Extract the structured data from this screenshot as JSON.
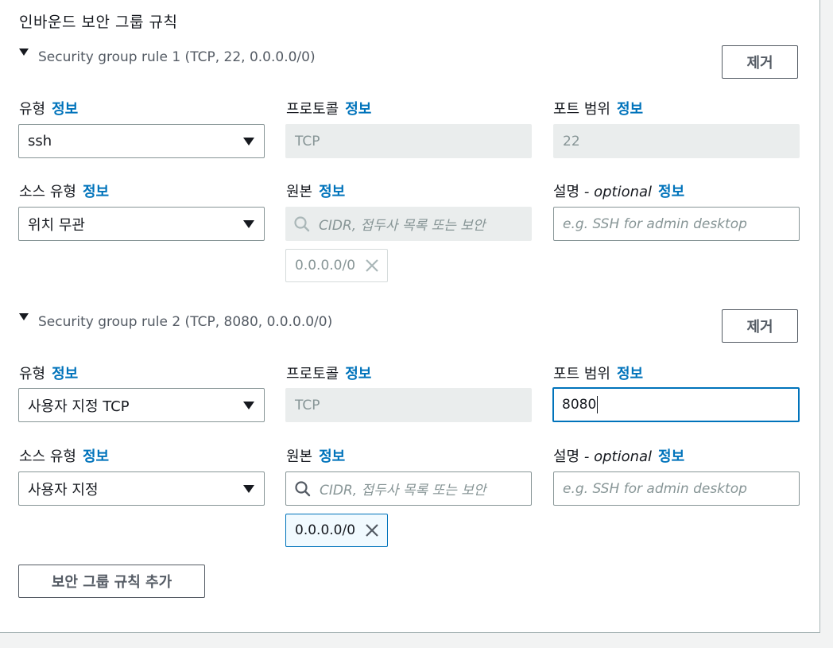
{
  "section_title": "인바운드 보안 그룹 규칙",
  "info_link": "정보",
  "remove_label": "제거",
  "add_rule_label": "보안 그룹 규칙 추가",
  "labels": {
    "type": "유형",
    "protocol": "프로토콜",
    "port_range": "포트 범위",
    "source_type": "소스 유형",
    "source": "원본",
    "description": "설명",
    "description_optional": "- optional"
  },
  "rules": [
    {
      "title": "Security group rule 1 (TCP, 22, 0.0.0.0/0)",
      "type_value": "ssh",
      "protocol_value": "TCP",
      "port_value": "22",
      "source_type_value": "위치 무관",
      "source_placeholder": "CIDR, 접두사 목록 또는 보안",
      "source_token": "0.0.0.0/0",
      "description_placeholder": "e.g. SSH for admin desktop"
    },
    {
      "title": "Security group rule 2 (TCP, 8080, 0.0.0.0/0)",
      "type_value": "사용자 지정 TCP",
      "protocol_value": "TCP",
      "port_value": "8080",
      "source_type_value": "사용자 지정",
      "source_placeholder": "CIDR, 접두사 목록 또는 보안",
      "source_token": "0.0.0.0/0",
      "description_placeholder": "e.g. SSH for admin desktop"
    }
  ],
  "icons": {
    "expand": "caret-down-icon",
    "dropdown": "dropdown-arrow-icon",
    "search": "search-icon",
    "remove_token": "close-icon"
  },
  "colors": {
    "info_link": "#0073bb",
    "focus_border": "#0073bb",
    "disabled_bg": "#eaeded",
    "token_active_bg": "#f1faff"
  }
}
